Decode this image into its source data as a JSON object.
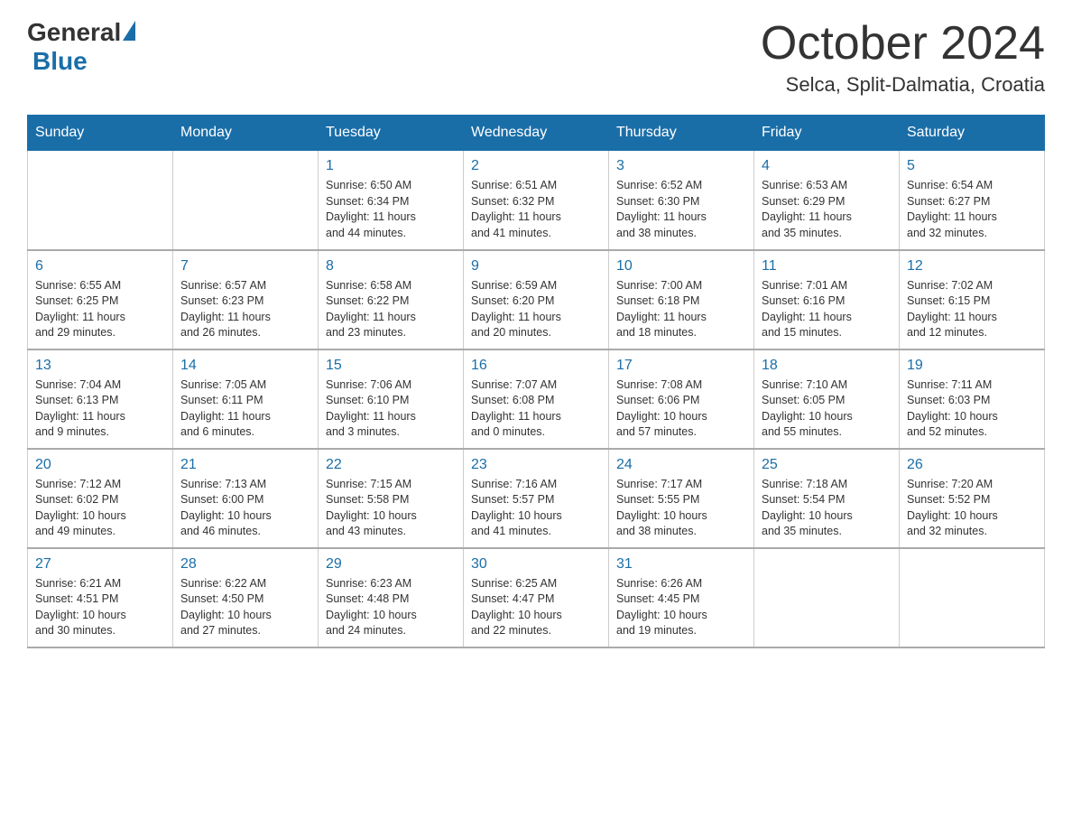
{
  "header": {
    "logo": {
      "general": "General",
      "blue": "Blue"
    },
    "title": "October 2024",
    "subtitle": "Selca, Split-Dalmatia, Croatia"
  },
  "calendar": {
    "weekdays": [
      "Sunday",
      "Monday",
      "Tuesday",
      "Wednesday",
      "Thursday",
      "Friday",
      "Saturday"
    ],
    "weeks": [
      [
        {
          "day": "",
          "info": ""
        },
        {
          "day": "",
          "info": ""
        },
        {
          "day": "1",
          "info": "Sunrise: 6:50 AM\nSunset: 6:34 PM\nDaylight: 11 hours\nand 44 minutes."
        },
        {
          "day": "2",
          "info": "Sunrise: 6:51 AM\nSunset: 6:32 PM\nDaylight: 11 hours\nand 41 minutes."
        },
        {
          "day": "3",
          "info": "Sunrise: 6:52 AM\nSunset: 6:30 PM\nDaylight: 11 hours\nand 38 minutes."
        },
        {
          "day": "4",
          "info": "Sunrise: 6:53 AM\nSunset: 6:29 PM\nDaylight: 11 hours\nand 35 minutes."
        },
        {
          "day": "5",
          "info": "Sunrise: 6:54 AM\nSunset: 6:27 PM\nDaylight: 11 hours\nand 32 minutes."
        }
      ],
      [
        {
          "day": "6",
          "info": "Sunrise: 6:55 AM\nSunset: 6:25 PM\nDaylight: 11 hours\nand 29 minutes."
        },
        {
          "day": "7",
          "info": "Sunrise: 6:57 AM\nSunset: 6:23 PM\nDaylight: 11 hours\nand 26 minutes."
        },
        {
          "day": "8",
          "info": "Sunrise: 6:58 AM\nSunset: 6:22 PM\nDaylight: 11 hours\nand 23 minutes."
        },
        {
          "day": "9",
          "info": "Sunrise: 6:59 AM\nSunset: 6:20 PM\nDaylight: 11 hours\nand 20 minutes."
        },
        {
          "day": "10",
          "info": "Sunrise: 7:00 AM\nSunset: 6:18 PM\nDaylight: 11 hours\nand 18 minutes."
        },
        {
          "day": "11",
          "info": "Sunrise: 7:01 AM\nSunset: 6:16 PM\nDaylight: 11 hours\nand 15 minutes."
        },
        {
          "day": "12",
          "info": "Sunrise: 7:02 AM\nSunset: 6:15 PM\nDaylight: 11 hours\nand 12 minutes."
        }
      ],
      [
        {
          "day": "13",
          "info": "Sunrise: 7:04 AM\nSunset: 6:13 PM\nDaylight: 11 hours\nand 9 minutes."
        },
        {
          "day": "14",
          "info": "Sunrise: 7:05 AM\nSunset: 6:11 PM\nDaylight: 11 hours\nand 6 minutes."
        },
        {
          "day": "15",
          "info": "Sunrise: 7:06 AM\nSunset: 6:10 PM\nDaylight: 11 hours\nand 3 minutes."
        },
        {
          "day": "16",
          "info": "Sunrise: 7:07 AM\nSunset: 6:08 PM\nDaylight: 11 hours\nand 0 minutes."
        },
        {
          "day": "17",
          "info": "Sunrise: 7:08 AM\nSunset: 6:06 PM\nDaylight: 10 hours\nand 57 minutes."
        },
        {
          "day": "18",
          "info": "Sunrise: 7:10 AM\nSunset: 6:05 PM\nDaylight: 10 hours\nand 55 minutes."
        },
        {
          "day": "19",
          "info": "Sunrise: 7:11 AM\nSunset: 6:03 PM\nDaylight: 10 hours\nand 52 minutes."
        }
      ],
      [
        {
          "day": "20",
          "info": "Sunrise: 7:12 AM\nSunset: 6:02 PM\nDaylight: 10 hours\nand 49 minutes."
        },
        {
          "day": "21",
          "info": "Sunrise: 7:13 AM\nSunset: 6:00 PM\nDaylight: 10 hours\nand 46 minutes."
        },
        {
          "day": "22",
          "info": "Sunrise: 7:15 AM\nSunset: 5:58 PM\nDaylight: 10 hours\nand 43 minutes."
        },
        {
          "day": "23",
          "info": "Sunrise: 7:16 AM\nSunset: 5:57 PM\nDaylight: 10 hours\nand 41 minutes."
        },
        {
          "day": "24",
          "info": "Sunrise: 7:17 AM\nSunset: 5:55 PM\nDaylight: 10 hours\nand 38 minutes."
        },
        {
          "day": "25",
          "info": "Sunrise: 7:18 AM\nSunset: 5:54 PM\nDaylight: 10 hours\nand 35 minutes."
        },
        {
          "day": "26",
          "info": "Sunrise: 7:20 AM\nSunset: 5:52 PM\nDaylight: 10 hours\nand 32 minutes."
        }
      ],
      [
        {
          "day": "27",
          "info": "Sunrise: 6:21 AM\nSunset: 4:51 PM\nDaylight: 10 hours\nand 30 minutes."
        },
        {
          "day": "28",
          "info": "Sunrise: 6:22 AM\nSunset: 4:50 PM\nDaylight: 10 hours\nand 27 minutes."
        },
        {
          "day": "29",
          "info": "Sunrise: 6:23 AM\nSunset: 4:48 PM\nDaylight: 10 hours\nand 24 minutes."
        },
        {
          "day": "30",
          "info": "Sunrise: 6:25 AM\nSunset: 4:47 PM\nDaylight: 10 hours\nand 22 minutes."
        },
        {
          "day": "31",
          "info": "Sunrise: 6:26 AM\nSunset: 4:45 PM\nDaylight: 10 hours\nand 19 minutes."
        },
        {
          "day": "",
          "info": ""
        },
        {
          "day": "",
          "info": ""
        }
      ]
    ]
  }
}
